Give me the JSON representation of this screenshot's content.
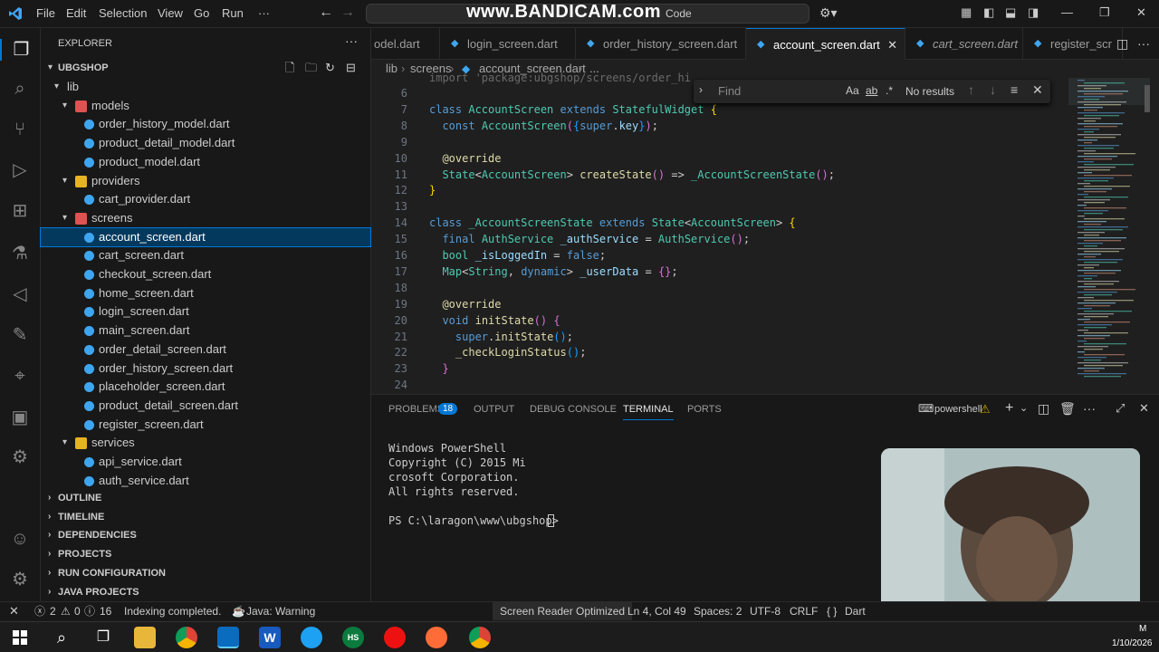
{
  "titlebar": {
    "menus": [
      "File",
      "Edit",
      "Selection",
      "View",
      "Go",
      "Run",
      "···"
    ],
    "command_center": "Code",
    "watermark": "www.BANDICAM.com"
  },
  "explorer": {
    "header": "EXPLORER",
    "workspace": "UBGSHOP",
    "tree": [
      {
        "label": "lib",
        "kind": "folder",
        "depth": 1,
        "open": true
      },
      {
        "label": "models",
        "kind": "folder-models",
        "depth": 2,
        "open": true
      },
      {
        "label": "order_history_model.dart",
        "kind": "dart",
        "depth": 3
      },
      {
        "label": "product_detail_model.dart",
        "kind": "dart",
        "depth": 3
      },
      {
        "label": "product_model.dart",
        "kind": "dart",
        "depth": 3
      },
      {
        "label": "providers",
        "kind": "folder-providers",
        "depth": 2,
        "open": true
      },
      {
        "label": "cart_provider.dart",
        "kind": "dart",
        "depth": 3
      },
      {
        "label": "screens",
        "kind": "folder-screens",
        "depth": 2,
        "open": true
      },
      {
        "label": "account_screen.dart",
        "kind": "dart",
        "depth": 3,
        "selected": true
      },
      {
        "label": "cart_screen.dart",
        "kind": "dart",
        "depth": 3
      },
      {
        "label": "checkout_screen.dart",
        "kind": "dart",
        "depth": 3
      },
      {
        "label": "home_screen.dart",
        "kind": "dart",
        "depth": 3
      },
      {
        "label": "login_screen.dart",
        "kind": "dart",
        "depth": 3
      },
      {
        "label": "main_screen.dart",
        "kind": "dart",
        "depth": 3
      },
      {
        "label": "order_detail_screen.dart",
        "kind": "dart",
        "depth": 3
      },
      {
        "label": "order_history_screen.dart",
        "kind": "dart",
        "depth": 3
      },
      {
        "label": "placeholder_screen.dart",
        "kind": "dart",
        "depth": 3
      },
      {
        "label": "product_detail_screen.dart",
        "kind": "dart",
        "depth": 3
      },
      {
        "label": "register_screen.dart",
        "kind": "dart",
        "depth": 3
      },
      {
        "label": "services",
        "kind": "folder-services",
        "depth": 2,
        "open": true
      },
      {
        "label": "api_service.dart",
        "kind": "dart",
        "depth": 3
      },
      {
        "label": "auth_service.dart",
        "kind": "dart",
        "depth": 3
      }
    ],
    "sections": [
      "OUTLINE",
      "TIMELINE",
      "DEPENDENCIES",
      "PROJECTS",
      "RUN CONFIGURATION",
      "JAVA PROJECTS"
    ]
  },
  "tabs": [
    {
      "label": "odel.dart",
      "italic": false
    },
    {
      "label": "login_screen.dart",
      "italic": false
    },
    {
      "label": "order_history_screen.dart",
      "italic": false
    },
    {
      "label": "account_screen.dart",
      "active": true
    },
    {
      "label": "cart_screen.dart",
      "italic": true
    },
    {
      "label": "register_scr",
      "italic": false
    }
  ],
  "breadcrumb": [
    "lib",
    "screens",
    "account_screen.dart",
    "..."
  ],
  "editor": {
    "top_partial": "import 'package:ubgshop/screens/order_hi",
    "lines": [
      {
        "n": "6",
        "html": ""
      },
      {
        "n": "7",
        "html": "<span class='kw'>class</span> <span class='ty'>AccountScreen</span> <span class='kw'>extends</span> <span class='ty'>StatefulWidget</span> <span class='br'>{</span>"
      },
      {
        "n": "8",
        "html": "  <span class='kw'>const</span> <span class='ty'>AccountScreen</span><span class='br2'>(</span><span class='br3'>{</span><span class='kw'>super</span>.<span class='va'>key</span><span class='br3'>}</span><span class='br2'>)</span>;"
      },
      {
        "n": "9",
        "html": ""
      },
      {
        "n": "10",
        "html": "  <span class='fn'>@override</span>"
      },
      {
        "n": "11",
        "html": "  <span class='ty'>State</span>&lt;<span class='ty'>AccountScreen</span>&gt; <span class='fn'>createState</span><span class='br2'>()</span> =&gt; <span class='ty'>_AccountScreenState</span><span class='br2'>()</span>;"
      },
      {
        "n": "12",
        "html": "<span class='br'>}</span>"
      },
      {
        "n": "13",
        "html": ""
      },
      {
        "n": "14",
        "html": "<span class='kw'>class</span> <span class='ty'>_AccountScreenState</span> <span class='kw'>extends</span> <span class='ty'>State</span>&lt;<span class='ty'>AccountScreen</span>&gt; <span class='br'>{</span>"
      },
      {
        "n": "15",
        "html": "  <span class='kw'>final</span> <span class='ty'>AuthService</span> <span class='va'>_authService</span> = <span class='ty'>AuthService</span><span class='br2'>()</span>;"
      },
      {
        "n": "16",
        "html": "  <span class='ty'>bool</span> <span class='va'>_isLoggedIn</span> = <span class='kw'>false</span>;"
      },
      {
        "n": "17",
        "html": "  <span class='ty'>Map</span>&lt;<span class='ty'>String</span>, <span class='kw'>dynamic</span>&gt; <span class='va'>_userData</span> = <span class='br2'>{}</span>;"
      },
      {
        "n": "18",
        "html": ""
      },
      {
        "n": "19",
        "html": "  <span class='fn'>@override</span>"
      },
      {
        "n": "20",
        "html": "  <span class='kw'>void</span> <span class='fn'>initState</span><span class='br2'>()</span> <span class='br2'>{</span>"
      },
      {
        "n": "21",
        "html": "    <span class='kw'>super</span>.<span class='fn'>initState</span><span class='br3'>()</span>;"
      },
      {
        "n": "22",
        "html": "    <span class='fn'>_checkLoginStatus</span><span class='br3'>()</span>;"
      },
      {
        "n": "23",
        "html": "  <span class='br2'>}</span>"
      },
      {
        "n": "24",
        "html": ""
      }
    ]
  },
  "find": {
    "placeholder": "Find",
    "case": "Aa",
    "word": "ab",
    "regex": ".*",
    "result": "No results"
  },
  "panel": {
    "tabs": [
      "PROBLEMS",
      "OUTPUT",
      "DEBUG CONSOLE",
      "TERMINAL",
      "PORTS"
    ],
    "problems_count": "18",
    "active": "TERMINAL",
    "shell": "powershell",
    "terminal_lines": [
      "Windows PowerShell",
      "Copyright (C) 2015 Mi",
      "crosoft Corporation.",
      "All rights reserved.",
      "",
      "PS C:\\laragon\\www\\ubgshop> "
    ]
  },
  "status": {
    "errors": "2",
    "warnings": "0",
    "info": "16",
    "indexing": "Indexing completed.",
    "java": "Java: Warning",
    "screen_reader": "Screen Reader Optimized",
    "position": "Ln 4, Col 49",
    "spaces": "Spaces: 2",
    "encoding": "UTF-8",
    "eol": "CRLF",
    "lang": "Dart"
  },
  "taskbar": {
    "clock_date": "1/10/2026",
    "clock_time": "M"
  },
  "colors": {
    "accent": "#0078d4",
    "selection": "#04395e",
    "problem_badge": "#0078d4"
  }
}
